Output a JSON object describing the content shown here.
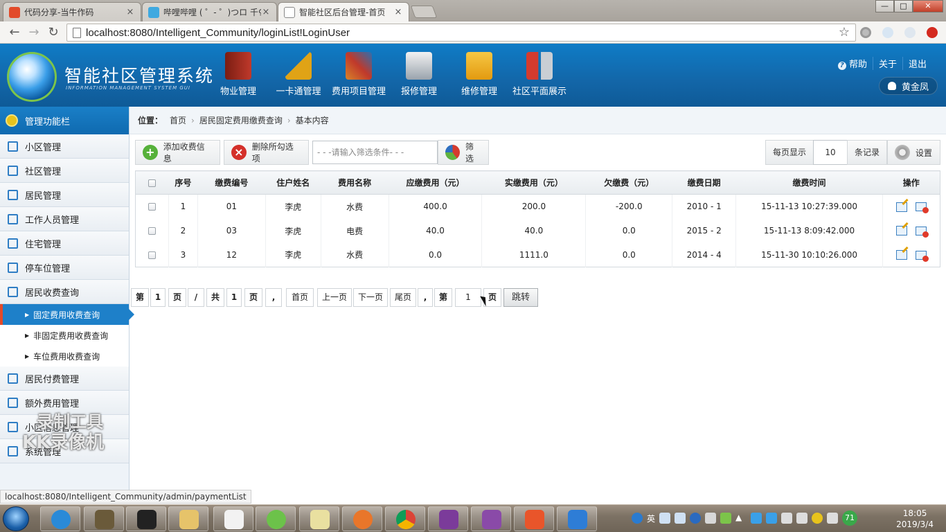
{
  "browser": {
    "tabs": [
      {
        "label": "代码分享-当牛作码",
        "close": "×"
      },
      {
        "label": "哔哩哔哩 ( ゜- ゜)つロ 千♀",
        "close": "×"
      },
      {
        "label": "智能社区后台管理-首页",
        "close": "×"
      }
    ],
    "window_buttons": {
      "minimize": "—",
      "maximize": "□",
      "close": "✕"
    },
    "nav": {
      "back": "←",
      "forward": "→",
      "reload": "↻"
    },
    "url": "localhost:8080/Intelligent_Community/loginList!LoginUser",
    "bookmark_star": "☆"
  },
  "header": {
    "title": "智能社区管理系统",
    "subtitle": "INFORMATION MANAGEMENT SYSTEM GUI",
    "nav": [
      {
        "label": "物业管理",
        "icon": "book-icon",
        "color": "#c0392b"
      },
      {
        "label": "一卡通管理",
        "icon": "ruler-icon",
        "color": "#e0a316"
      },
      {
        "label": "费用项目管理",
        "icon": "tools-icon",
        "color": "#d8832a"
      },
      {
        "label": "报修管理",
        "icon": "printer-icon",
        "color": "#c9ced4"
      },
      {
        "label": "维修管理",
        "icon": "folder-icon",
        "color": "#f0b325"
      },
      {
        "label": "社区平面展示",
        "icon": "screwdriver-icon",
        "color": "#d43b2e"
      }
    ],
    "links": {
      "help": "帮助",
      "about": "关于",
      "logout": "退出"
    },
    "user": "黄金凤"
  },
  "sidebar": {
    "title": "管理功能栏",
    "items": [
      {
        "label": "小区管理"
      },
      {
        "label": "社区管理"
      },
      {
        "label": "居民管理"
      },
      {
        "label": "工作人员管理"
      },
      {
        "label": "住宅管理"
      },
      {
        "label": "停车位管理"
      },
      {
        "label": "居民收费查询"
      }
    ],
    "subitems": [
      {
        "label": "固定费用收费查询",
        "active": true
      },
      {
        "label": "非固定费用收费查询",
        "active": false
      },
      {
        "label": "车位费用收费查询",
        "active": false
      }
    ],
    "items_after": [
      {
        "label": "居民付费管理"
      },
      {
        "label": "额外费用管理"
      },
      {
        "label": "小区信息管理"
      },
      {
        "label": "系统管理"
      }
    ]
  },
  "breadcrumb": {
    "prefix": "位置：",
    "parts": [
      "首页",
      "居民固定费用缴费查询",
      "基本内容"
    ]
  },
  "actions": {
    "add": "添加收费信息",
    "delete": "删除所勾选项",
    "filter_placeholder": "- - -请输入筛选条件- - -",
    "filter": "筛选",
    "per_page_label": "每页显示",
    "per_page_value": "10",
    "records_label": "条记录",
    "settings": "设置"
  },
  "table": {
    "columns": [
      "序号",
      "缴费编号",
      "住户姓名",
      "费用名称",
      "应缴费用（元）",
      "实缴费用（元）",
      "欠缴费（元）",
      "缴费日期",
      "缴费时间",
      "操作"
    ],
    "rows": [
      {
        "no": "1",
        "code": "01",
        "name": "李虎",
        "fee": "水费",
        "due": "400.0",
        "paid": "200.0",
        "owed": "-200.0",
        "date": "2010 - 1",
        "time": "15-11-13 10:27:39.000",
        "negative": true
      },
      {
        "no": "2",
        "code": "03",
        "name": "李虎",
        "fee": "电费",
        "due": "40.0",
        "paid": "40.0",
        "owed": "0.0",
        "date": "2015 - 2",
        "time": "15-11-13 8:09:42.000",
        "negative": false
      },
      {
        "no": "3",
        "code": "12",
        "name": "李虎",
        "fee": "水费",
        "due": "0.0",
        "paid": "1111.0",
        "owed": "0.0",
        "date": "2014 - 4",
        "time": "15-11-30 10:10:26.000",
        "negative": false
      }
    ]
  },
  "pager": {
    "di": "第",
    "page": "1",
    "ye": "页",
    "slash": "/",
    "gong": "共",
    "total": "1",
    "ye2": "页",
    "comma": ",",
    "first": "首页",
    "prev": "上一页",
    "next": "下一页",
    "last": "尾页",
    "comma2": ",",
    "di2": "第",
    "jump_value": "1",
    "ye3": "页",
    "jump": "跳转"
  },
  "status_url": "localhost:8080/Intelligent_Community/admin/paymentList",
  "watermark": {
    "line1": "录制工具",
    "line2": "KK录像机"
  },
  "taskbar": {
    "tray_lang": "英",
    "tray_badge": "71",
    "time": "18:05",
    "date": "2019/3/4"
  }
}
